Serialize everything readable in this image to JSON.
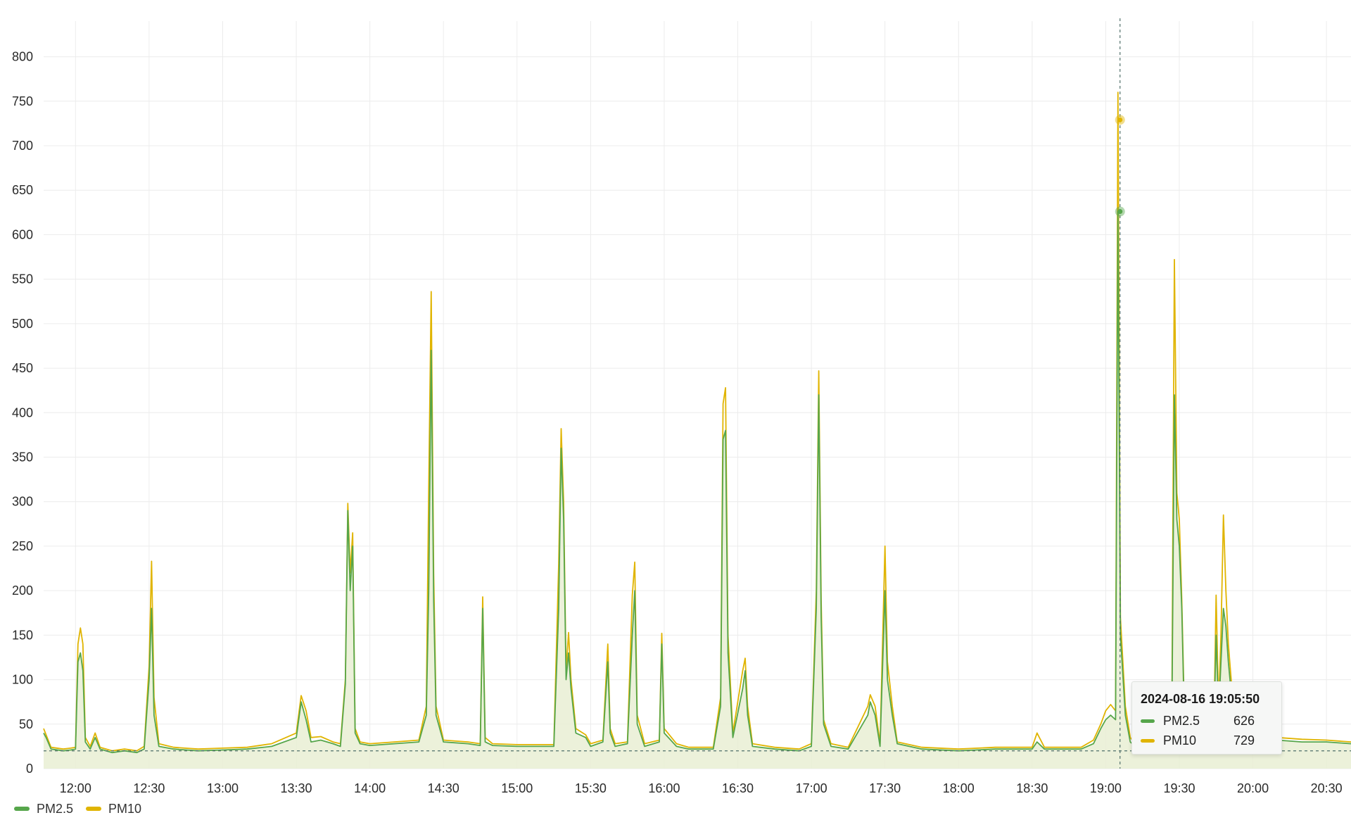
{
  "chart_data": {
    "type": "line",
    "x_axis": {
      "type": "time",
      "start": "2024-08-16 11:47",
      "end": "2024-08-16 20:40",
      "tick_labels": [
        "12:00",
        "12:30",
        "13:00",
        "13:30",
        "14:00",
        "14:30",
        "15:00",
        "15:30",
        "16:00",
        "16:30",
        "17:00",
        "17:30",
        "18:00",
        "18:30",
        "19:00",
        "19:30",
        "20:00",
        "20:30"
      ]
    },
    "y_axis": {
      "ylim": [
        0,
        840
      ],
      "tick_labels": [
        "0",
        "50",
        "100",
        "150",
        "200",
        "250",
        "300",
        "350",
        "400",
        "450",
        "500",
        "550",
        "600",
        "650",
        "700",
        "750",
        "800"
      ]
    },
    "grid": true,
    "baseline": 20,
    "series": [
      {
        "name": "PM2.5",
        "color": "#56a64b",
        "fill": true,
        "points": [
          [
            "11:47",
            40
          ],
          [
            "11:48",
            35
          ],
          [
            "11:50",
            22
          ],
          [
            "11:55",
            20
          ],
          [
            "11:58",
            21
          ],
          [
            "12:00",
            22
          ],
          [
            "12:01",
            120
          ],
          [
            "12:02",
            130
          ],
          [
            "12:03",
            110
          ],
          [
            "12:04",
            30
          ],
          [
            "12:06",
            22
          ],
          [
            "12:08",
            35
          ],
          [
            "12:10",
            22
          ],
          [
            "12:15",
            18
          ],
          [
            "12:20",
            20
          ],
          [
            "12:25",
            18
          ],
          [
            "12:28",
            22
          ],
          [
            "12:30",
            100
          ],
          [
            "12:31",
            180
          ],
          [
            "12:32",
            60
          ],
          [
            "12:34",
            25
          ],
          [
            "12:40",
            22
          ],
          [
            "12:50",
            20
          ],
          [
            "13:00",
            21
          ],
          [
            "13:10",
            22
          ],
          [
            "13:20",
            25
          ],
          [
            "13:30",
            35
          ],
          [
            "13:32",
            75
          ],
          [
            "13:34",
            55
          ],
          [
            "13:36",
            30
          ],
          [
            "13:40",
            32
          ],
          [
            "13:45",
            28
          ],
          [
            "13:48",
            25
          ],
          [
            "13:50",
            95
          ],
          [
            "13:51",
            290
          ],
          [
            "13:52",
            200
          ],
          [
            "13:53",
            250
          ],
          [
            "13:54",
            40
          ],
          [
            "13:56",
            28
          ],
          [
            "14:00",
            26
          ],
          [
            "14:10",
            28
          ],
          [
            "14:20",
            30
          ],
          [
            "14:23",
            60
          ],
          [
            "14:24",
            200
          ],
          [
            "14:25",
            470
          ],
          [
            "14:26",
            190
          ],
          [
            "14:27",
            60
          ],
          [
            "14:30",
            30
          ],
          [
            "14:40",
            28
          ],
          [
            "14:45",
            26
          ],
          [
            "14:46",
            180
          ],
          [
            "14:47",
            30
          ],
          [
            "14:50",
            26
          ],
          [
            "15:00",
            25
          ],
          [
            "15:10",
            25
          ],
          [
            "15:15",
            25
          ],
          [
            "15:17",
            180
          ],
          [
            "15:18",
            360
          ],
          [
            "15:19",
            280
          ],
          [
            "15:20",
            100
          ],
          [
            "15:21",
            130
          ],
          [
            "15:22",
            90
          ],
          [
            "15:24",
            40
          ],
          [
            "15:28",
            35
          ],
          [
            "15:30",
            25
          ],
          [
            "15:35",
            30
          ],
          [
            "15:37",
            120
          ],
          [
            "15:38",
            40
          ],
          [
            "15:40",
            25
          ],
          [
            "15:45",
            28
          ],
          [
            "15:47",
            150
          ],
          [
            "15:48",
            200
          ],
          [
            "15:49",
            50
          ],
          [
            "15:52",
            25
          ],
          [
            "15:58",
            30
          ],
          [
            "15:59",
            140
          ],
          [
            "16:00",
            40
          ],
          [
            "16:05",
            25
          ],
          [
            "16:10",
            22
          ],
          [
            "16:20",
            22
          ],
          [
            "16:23",
            70
          ],
          [
            "16:24",
            370
          ],
          [
            "16:25",
            380
          ],
          [
            "16:26",
            130
          ],
          [
            "16:28",
            35
          ],
          [
            "16:32",
            90
          ],
          [
            "16:33",
            110
          ],
          [
            "16:34",
            60
          ],
          [
            "16:36",
            25
          ],
          [
            "16:45",
            22
          ],
          [
            "16:55",
            20
          ],
          [
            "17:00",
            25
          ],
          [
            "17:02",
            180
          ],
          [
            "17:03",
            420
          ],
          [
            "17:04",
            170
          ],
          [
            "17:05",
            50
          ],
          [
            "17:08",
            25
          ],
          [
            "17:15",
            22
          ],
          [
            "17:23",
            60
          ],
          [
            "17:24",
            75
          ],
          [
            "17:26",
            60
          ],
          [
            "17:28",
            25
          ],
          [
            "17:30",
            200
          ],
          [
            "17:31",
            100
          ],
          [
            "17:33",
            60
          ],
          [
            "17:35",
            28
          ],
          [
            "17:45",
            22
          ],
          [
            "18:00",
            20
          ],
          [
            "18:15",
            22
          ],
          [
            "18:30",
            22
          ],
          [
            "18:32",
            30
          ],
          [
            "18:35",
            22
          ],
          [
            "18:50",
            22
          ],
          [
            "18:55",
            28
          ],
          [
            "18:58",
            45
          ],
          [
            "19:00",
            55
          ],
          [
            "19:02",
            60
          ],
          [
            "19:04",
            55
          ],
          [
            "19:05",
            626
          ],
          [
            "19:06",
            150
          ],
          [
            "19:08",
            60
          ],
          [
            "19:10",
            30
          ],
          [
            "19:12",
            25
          ],
          [
            "19:22",
            25
          ],
          [
            "19:26",
            25
          ],
          [
            "19:27",
            60
          ],
          [
            "19:28",
            420
          ],
          [
            "19:29",
            280
          ],
          [
            "19:30",
            250
          ],
          [
            "19:31",
            180
          ],
          [
            "19:32",
            60
          ],
          [
            "19:34",
            25
          ],
          [
            "19:44",
            30
          ],
          [
            "19:45",
            150
          ],
          [
            "19:46",
            60
          ],
          [
            "19:47",
            120
          ],
          [
            "19:48",
            180
          ],
          [
            "19:49",
            160
          ],
          [
            "19:50",
            120
          ],
          [
            "19:52",
            60
          ],
          [
            "19:55",
            40
          ],
          [
            "20:00",
            35
          ],
          [
            "20:10",
            32
          ],
          [
            "20:20",
            30
          ],
          [
            "20:30",
            30
          ],
          [
            "20:40",
            28
          ]
        ]
      },
      {
        "name": "PM10",
        "color": "#e0b400",
        "fill": false,
        "points": [
          [
            "11:47",
            45
          ],
          [
            "11:48",
            38
          ],
          [
            "11:50",
            24
          ],
          [
            "11:55",
            22
          ],
          [
            "11:58",
            23
          ],
          [
            "12:00",
            24
          ],
          [
            "12:01",
            140
          ],
          [
            "12:02",
            158
          ],
          [
            "12:03",
            140
          ],
          [
            "12:04",
            35
          ],
          [
            "12:06",
            25
          ],
          [
            "12:08",
            40
          ],
          [
            "12:10",
            24
          ],
          [
            "12:15",
            20
          ],
          [
            "12:20",
            22
          ],
          [
            "12:25",
            20
          ],
          [
            "12:28",
            25
          ],
          [
            "12:30",
            115
          ],
          [
            "12:31",
            233
          ],
          [
            "12:32",
            80
          ],
          [
            "12:34",
            28
          ],
          [
            "12:40",
            24
          ],
          [
            "12:50",
            22
          ],
          [
            "13:00",
            23
          ],
          [
            "13:10",
            24
          ],
          [
            "13:20",
            28
          ],
          [
            "13:30",
            40
          ],
          [
            "13:32",
            82
          ],
          [
            "13:34",
            65
          ],
          [
            "13:36",
            35
          ],
          [
            "13:40",
            36
          ],
          [
            "13:45",
            30
          ],
          [
            "13:48",
            28
          ],
          [
            "13:50",
            100
          ],
          [
            "13:51",
            298
          ],
          [
            "13:52",
            220
          ],
          [
            "13:53",
            265
          ],
          [
            "13:54",
            45
          ],
          [
            "13:56",
            30
          ],
          [
            "14:00",
            28
          ],
          [
            "14:10",
            30
          ],
          [
            "14:20",
            32
          ],
          [
            "14:23",
            70
          ],
          [
            "14:24",
            315
          ],
          [
            "14:25",
            536
          ],
          [
            "14:26",
            220
          ],
          [
            "14:27",
            70
          ],
          [
            "14:30",
            32
          ],
          [
            "14:40",
            30
          ],
          [
            "14:45",
            28
          ],
          [
            "14:46",
            193
          ],
          [
            "14:47",
            35
          ],
          [
            "14:50",
            28
          ],
          [
            "15:00",
            27
          ],
          [
            "15:10",
            27
          ],
          [
            "15:15",
            27
          ],
          [
            "15:17",
            230
          ],
          [
            "15:18",
            382
          ],
          [
            "15:19",
            300
          ],
          [
            "15:20",
            110
          ],
          [
            "15:21",
            153
          ],
          [
            "15:22",
            100
          ],
          [
            "15:24",
            45
          ],
          [
            "15:28",
            38
          ],
          [
            "15:30",
            28
          ],
          [
            "15:35",
            32
          ],
          [
            "15:37",
            140
          ],
          [
            "15:38",
            45
          ],
          [
            "15:40",
            28
          ],
          [
            "15:45",
            30
          ],
          [
            "15:47",
            195
          ],
          [
            "15:48",
            232
          ],
          [
            "15:49",
            60
          ],
          [
            "15:52",
            28
          ],
          [
            "15:58",
            32
          ],
          [
            "15:59",
            152
          ],
          [
            "16:00",
            45
          ],
          [
            "16:05",
            28
          ],
          [
            "16:10",
            24
          ],
          [
            "16:20",
            24
          ],
          [
            "16:23",
            80
          ],
          [
            "16:24",
            410
          ],
          [
            "16:25",
            428
          ],
          [
            "16:26",
            150
          ],
          [
            "16:28",
            40
          ],
          [
            "16:32",
            110
          ],
          [
            "16:33",
            124
          ],
          [
            "16:34",
            70
          ],
          [
            "16:36",
            28
          ],
          [
            "16:45",
            24
          ],
          [
            "16:55",
            22
          ],
          [
            "17:00",
            28
          ],
          [
            "17:02",
            200
          ],
          [
            "17:03",
            447
          ],
          [
            "17:04",
            190
          ],
          [
            "17:05",
            55
          ],
          [
            "17:08",
            28
          ],
          [
            "17:15",
            24
          ],
          [
            "17:23",
            70
          ],
          [
            "17:24",
            83
          ],
          [
            "17:26",
            70
          ],
          [
            "17:28",
            28
          ],
          [
            "17:30",
            250
          ],
          [
            "17:31",
            120
          ],
          [
            "17:33",
            70
          ],
          [
            "17:35",
            30
          ],
          [
            "17:45",
            24
          ],
          [
            "18:00",
            22
          ],
          [
            "18:15",
            24
          ],
          [
            "18:30",
            24
          ],
          [
            "18:32",
            40
          ],
          [
            "18:35",
            24
          ],
          [
            "18:50",
            24
          ],
          [
            "18:55",
            32
          ],
          [
            "18:58",
            50
          ],
          [
            "19:00",
            65
          ],
          [
            "19:02",
            72
          ],
          [
            "19:04",
            65
          ],
          [
            "19:05",
            760
          ],
          [
            "19:06",
            170
          ],
          [
            "19:08",
            70
          ],
          [
            "19:10",
            35
          ],
          [
            "19:12",
            28
          ],
          [
            "19:22",
            28
          ],
          [
            "19:26",
            28
          ],
          [
            "19:27",
            80
          ],
          [
            "19:28",
            572
          ],
          [
            "19:29",
            310
          ],
          [
            "19:30",
            280
          ],
          [
            "19:31",
            190
          ],
          [
            "19:32",
            70
          ],
          [
            "19:34",
            28
          ],
          [
            "19:44",
            32
          ],
          [
            "19:45",
            195
          ],
          [
            "19:46",
            70
          ],
          [
            "19:47",
            150
          ],
          [
            "19:48",
            285
          ],
          [
            "19:49",
            200
          ],
          [
            "19:50",
            140
          ],
          [
            "19:52",
            70
          ],
          [
            "19:55",
            45
          ],
          [
            "20:00",
            38
          ],
          [
            "20:10",
            35
          ],
          [
            "20:20",
            33
          ],
          [
            "20:30",
            32
          ],
          [
            "20:40",
            30
          ]
        ]
      }
    ],
    "crosshair": {
      "x": "19:05:50",
      "values": {
        "PM2.5": 626,
        "PM10": 729
      }
    },
    "tooltip": {
      "time": "2024-08-16 19:05:50",
      "rows": [
        {
          "name": "PM2.5",
          "value": "626",
          "color": "#56a64b"
        },
        {
          "name": "PM10",
          "value": "729",
          "color": "#e0b400"
        }
      ]
    },
    "legend": {
      "position": "bottom-left",
      "items": [
        {
          "name": "PM2.5",
          "color": "#56a64b"
        },
        {
          "name": "PM10",
          "color": "#e0b400"
        }
      ]
    }
  }
}
